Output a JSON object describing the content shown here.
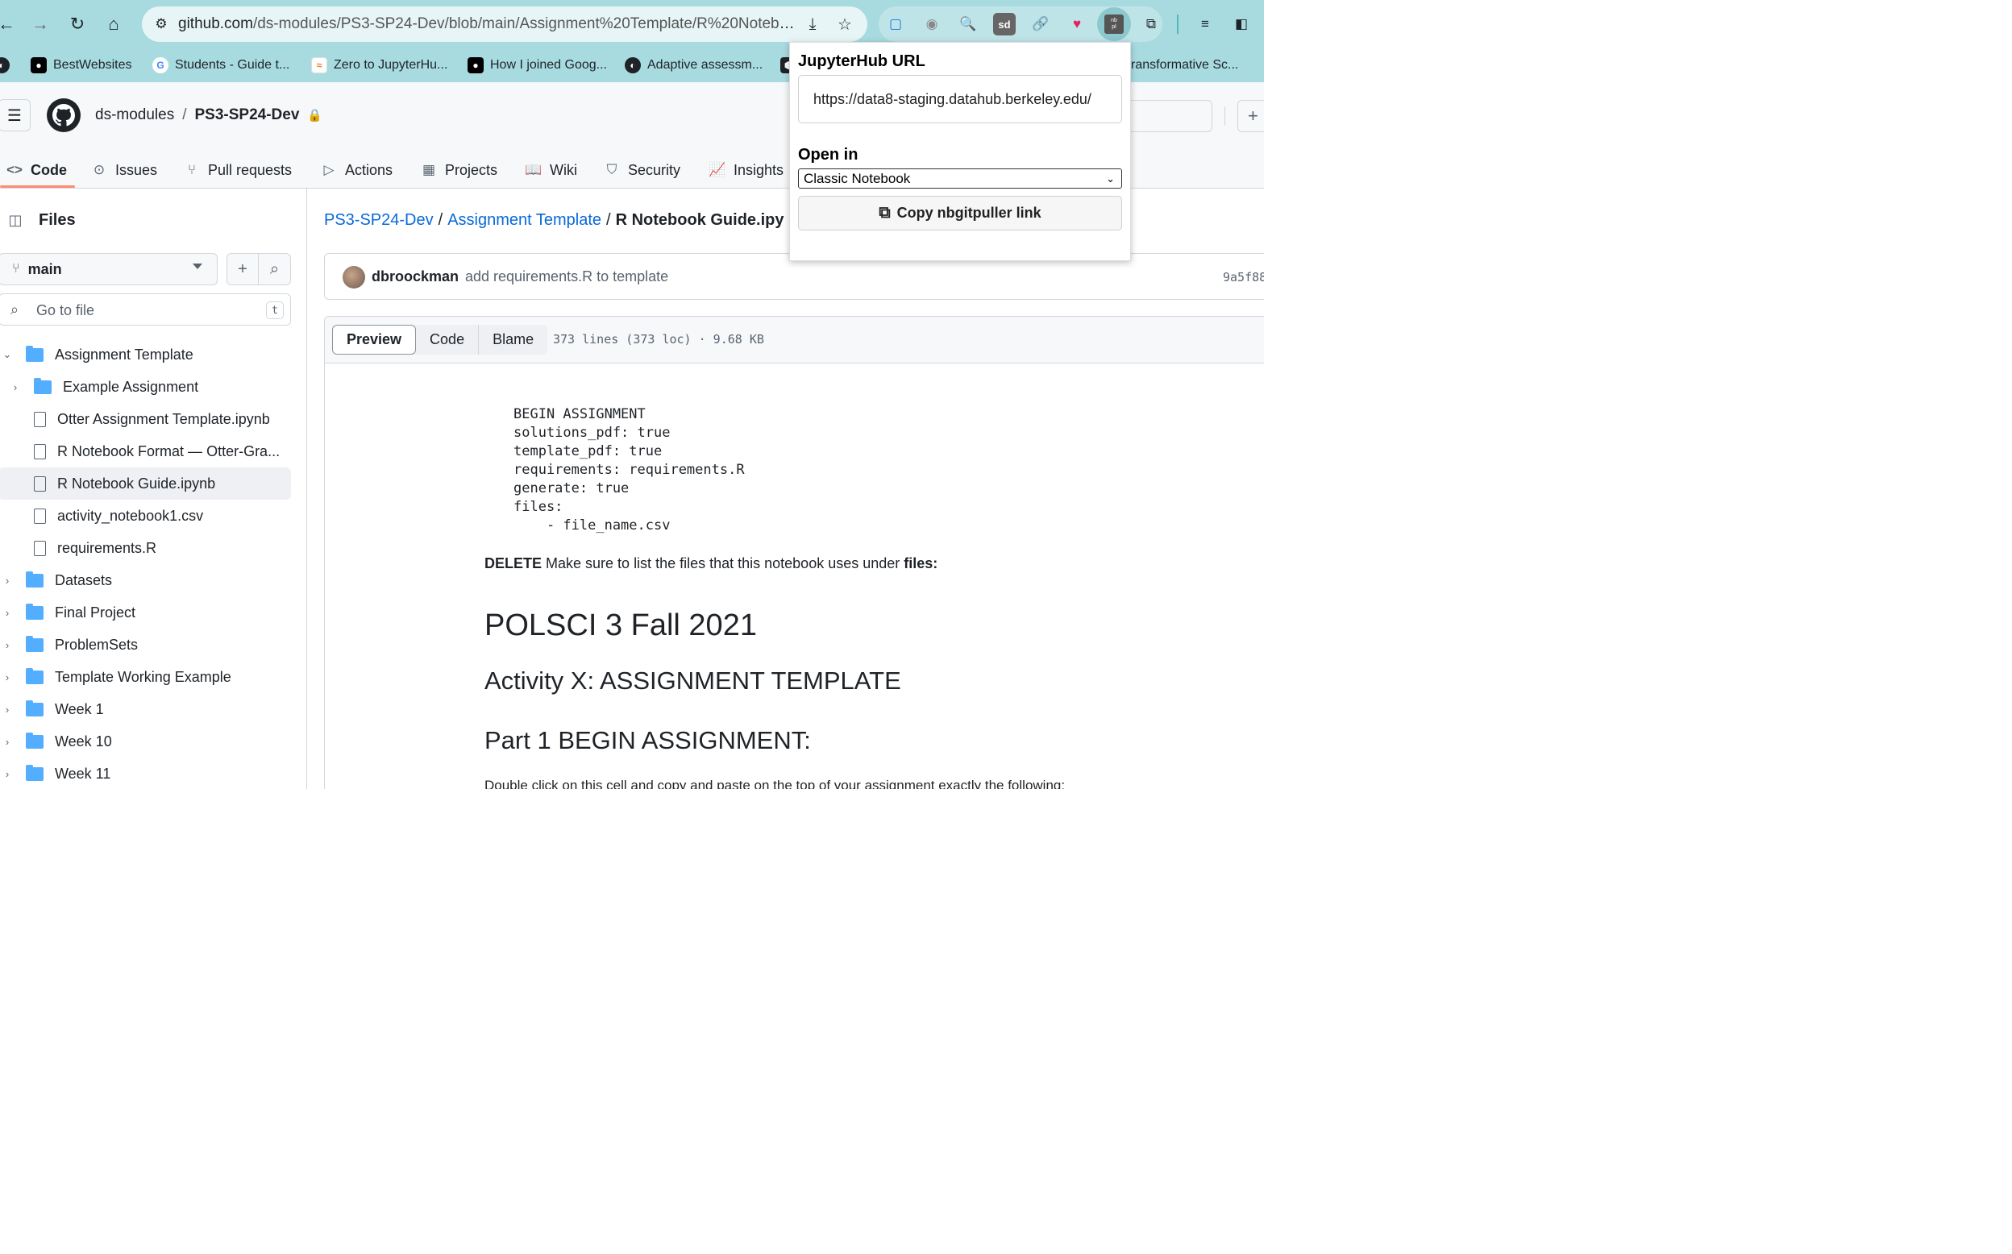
{
  "browser": {
    "url_host": "github.com",
    "url_path": "/ds-modules/PS3-SP24-Dev/blob/main/Assignment%20Template/R%20Notebo..."
  },
  "bookmarks": [
    {
      "label": "BestWebsites"
    },
    {
      "label": "Students - Guide t..."
    },
    {
      "label": "Zero to JupyterHu..."
    },
    {
      "label": "How I joined Goog..."
    },
    {
      "label": "Adaptive assessm..."
    },
    {
      "label": "ransformative Sc..."
    }
  ],
  "repo": {
    "owner": "ds-modules",
    "separator": "/",
    "name": "PS3-SP24-Dev"
  },
  "tabs": [
    {
      "label": "Code"
    },
    {
      "label": "Issues"
    },
    {
      "label": "Pull requests"
    },
    {
      "label": "Actions"
    },
    {
      "label": "Projects"
    },
    {
      "label": "Wiki"
    },
    {
      "label": "Security"
    },
    {
      "label": "Insights"
    }
  ],
  "sidebar": {
    "title": "Files",
    "branch": "main",
    "goto_placeholder": "Go to file",
    "goto_shortcut": "t",
    "tree": [
      {
        "label": "Assignment Template",
        "type": "folder",
        "expanded": true
      },
      {
        "label": "Example Assignment",
        "type": "folder",
        "expanded": false
      },
      {
        "label": "Otter Assignment Template.ipynb",
        "type": "file"
      },
      {
        "label": "R Notebook Format — Otter-Gra...",
        "type": "file"
      },
      {
        "label": "R Notebook Guide.ipynb",
        "type": "file",
        "selected": true
      },
      {
        "label": "activity_notebook1.csv",
        "type": "file"
      },
      {
        "label": "requirements.R",
        "type": "file"
      },
      {
        "label": "Datasets",
        "type": "folder"
      },
      {
        "label": "Final Project",
        "type": "folder"
      },
      {
        "label": "ProblemSets",
        "type": "folder"
      },
      {
        "label": "Template Working Example",
        "type": "folder"
      },
      {
        "label": "Week 1",
        "type": "folder"
      },
      {
        "label": "Week 10",
        "type": "folder"
      },
      {
        "label": "Week 11",
        "type": "folder"
      }
    ]
  },
  "path": {
    "repo": "PS3-SP24-Dev",
    "folder": "Assignment Template",
    "file": "R Notebook Guide.ipy",
    "sep": "/"
  },
  "commit": {
    "author": "dbroockman",
    "message": "add requirements.R to template",
    "hash": "9a5f88"
  },
  "file_view": {
    "tabs": [
      "Preview",
      "Code",
      "Blame"
    ],
    "meta": "373 lines (373 loc) · 9.68 KB"
  },
  "notebook": {
    "code": "BEGIN ASSIGNMENT\nsolutions_pdf: true\ntemplate_pdf: true\nrequirements: requirements.R\ngenerate: true\nfiles:\n    - file_name.csv",
    "delete_bold": "DELETE",
    "delete_text": " Make sure to list the files that this notebook uses under ",
    "delete_tail": "files:",
    "h1": "POLSCI 3 Fall 2021",
    "h2": "Activity X: ASSIGNMENT TEMPLATE",
    "h3": "Part 1 BEGIN ASSIGNMENT:",
    "tail": "Double click on this cell and copy and paste on the top of your assignment exactly the following:"
  },
  "popup": {
    "url_label": "JupyterHub URL",
    "url_value": "https://data8-staging.datahub.berkeley.edu/",
    "open_label": "Open in",
    "open_value": "Classic Notebook",
    "copy_label": "Copy nbgitpuller link"
  }
}
